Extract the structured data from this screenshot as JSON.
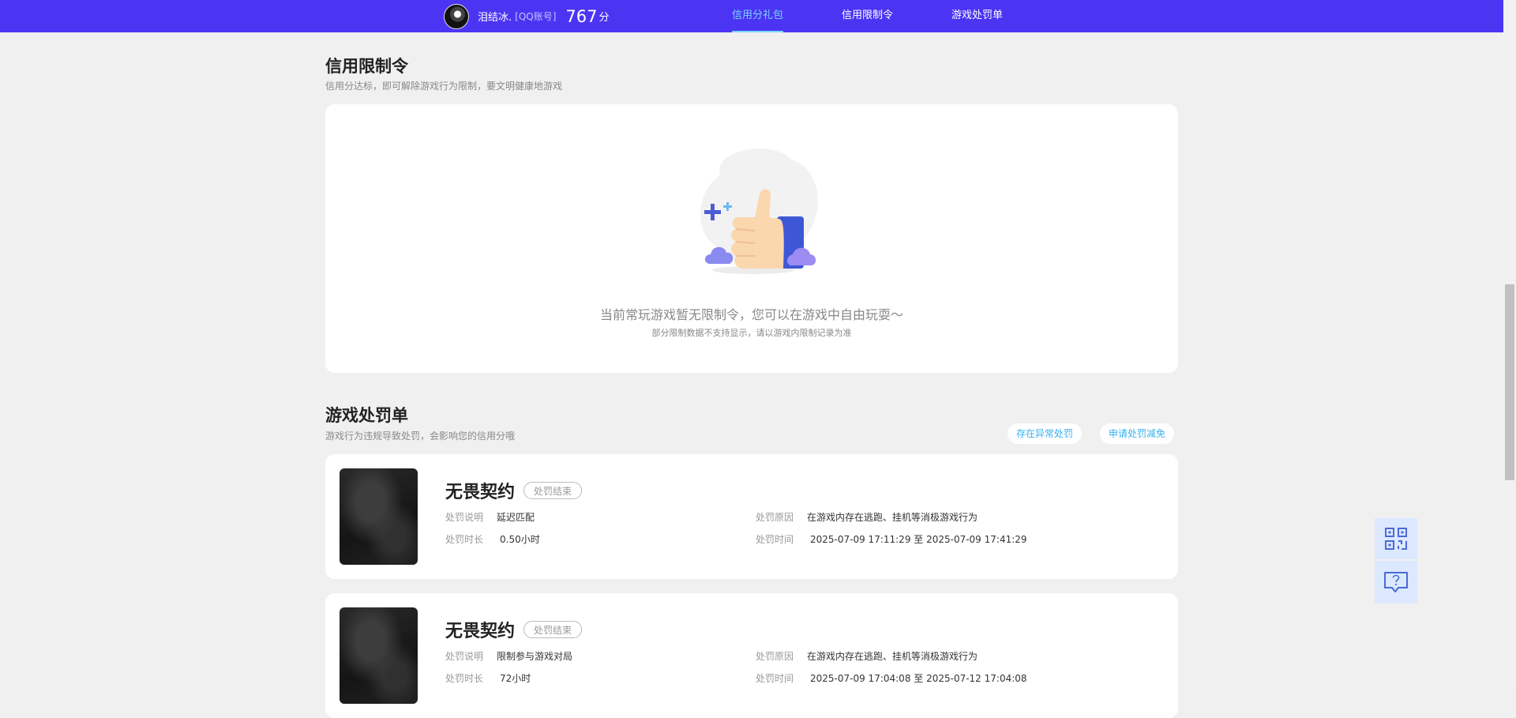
{
  "header": {
    "username": "泪结冰.",
    "account_type": "[QQ账号]",
    "score": "767",
    "score_unit": "分",
    "nav": [
      {
        "label": "信用分礼包",
        "active": true
      },
      {
        "label": "信用限制令",
        "active": false
      },
      {
        "label": "游戏处罚单",
        "active": false
      }
    ]
  },
  "restriction": {
    "title": "信用限制令",
    "subtitle": "信用分达标，即可解除游戏行为限制，要文明健康地游戏",
    "empty_text": "当前常玩游戏暂无限制令，您可以在游戏中自由玩耍～",
    "empty_note": "部分限制数据不支持显示，请以游戏内限制记录为准"
  },
  "penalty": {
    "title": "游戏处罚单",
    "subtitle": "游戏行为违规导致处罚，会影响您的信用分哦",
    "btn_abnormal": "存在异常处罚",
    "btn_appeal": "申请处罚减免",
    "labels": {
      "desc": "处罚说明",
      "duration": "处罚时长",
      "reason": "处罚原因",
      "time": "处罚时间"
    },
    "items": [
      {
        "game": "无畏契约",
        "status": "处罚结束",
        "desc": "延迟匹配",
        "duration": "0.50小时",
        "reason": "在游戏内存在逃跑、挂机等消极游戏行为",
        "time": "2025-07-09 17:11:29 至 2025-07-09 17:41:29"
      },
      {
        "game": "无畏契约",
        "status": "处罚结束",
        "desc": "限制参与游戏对局",
        "duration": "72小时",
        "reason": "在游戏内存在逃跑、挂机等消极游戏行为",
        "time": "2025-07-09 17:04:08 至 2025-07-12 17:04:08"
      }
    ]
  },
  "floating": {
    "qr_icon": "qrcode-icon",
    "help_icon": "help-chat-icon"
  },
  "colors": {
    "header_bg": "#4b35f3",
    "nav_active": "#7ed4ff",
    "pill_text": "#35b0f0"
  }
}
